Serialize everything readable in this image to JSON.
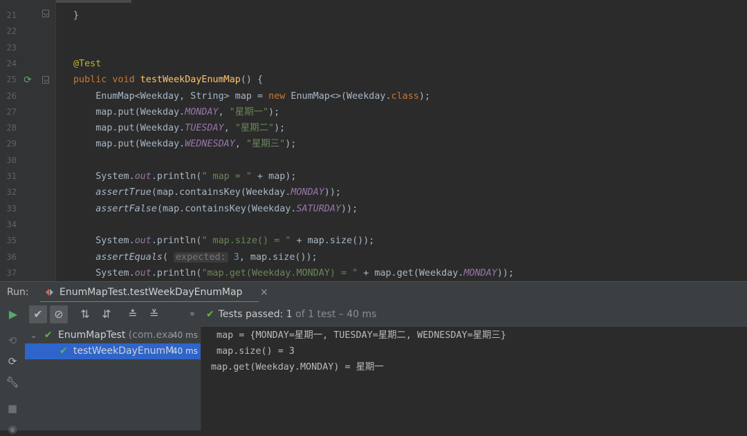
{
  "editor": {
    "lines": [
      {
        "n": "21",
        "html": "<span>}</span>"
      },
      {
        "n": "22",
        "html": ""
      },
      {
        "n": "23",
        "html": ""
      },
      {
        "n": "24",
        "html": "<span class=\"ann\">@Test</span>"
      },
      {
        "n": "25",
        "html": "<span class=\"kw\">public void </span><span class=\"fn\">testWeekDayEnumMap</span>() {"
      },
      {
        "n": "26",
        "html": "    EnumMap&lt;Weekday, String&gt; map = <span class=\"kw\">new </span>EnumMap&lt;&gt;(Weekday.<span class=\"kw\">class</span>);"
      },
      {
        "n": "27",
        "html": "    map.put(Weekday.<span class=\"stat\">MONDAY</span>, <span class=\"str\">\"星期一\"</span>);"
      },
      {
        "n": "28",
        "html": "    map.put(Weekday.<span class=\"stat\">TUESDAY</span>, <span class=\"str\">\"星期二\"</span>);"
      },
      {
        "n": "29",
        "html": "    map.put(Weekday.<span class=\"stat\">WEDNESDAY</span>, <span class=\"str\">\"星期三\"</span>);"
      },
      {
        "n": "30",
        "html": ""
      },
      {
        "n": "31",
        "html": "    System.<span class=\"field\">out</span>.println(<span class=\"str\">\" map = \"</span> + map);"
      },
      {
        "n": "32",
        "html": "    <span class=\"ital\">assertTrue</span>(map.containsKey(Weekday.<span class=\"stat\">MONDAY</span>));"
      },
      {
        "n": "33",
        "html": "    <span class=\"ital\">assertFalse</span>(map.containsKey(Weekday.<span class=\"stat\">SATURDAY</span>));"
      },
      {
        "n": "34",
        "html": ""
      },
      {
        "n": "35",
        "html": "    System.<span class=\"field\">out</span>.println(<span class=\"str\">\" map.size() = \"</span> + map.size());"
      },
      {
        "n": "36",
        "html": "    <span class=\"ital\">assertEquals</span>( <span class=\"hint\">expected:</span> <span class=\"num\">3</span>, map.size());"
      },
      {
        "n": "37",
        "html": "    System.<span class=\"field\">out</span>.println(<span class=\"str\">\"map.get(Weekday.MONDAY) = \"</span> + map.get(Weekday.<span class=\"stat\">MONDAY</span>));"
      }
    ]
  },
  "run_panel": {
    "label": "Run:",
    "tab_title": "EnumMapTest.testWeekDayEnumMap",
    "tab_close": "×",
    "status_prefix": "Tests passed: ",
    "status_count": "1",
    "status_suffix": " of 1 test – 40 ms",
    "tree": [
      {
        "name": "EnumMapTest",
        "pkg": " (com.exa",
        "time": "40 ms"
      },
      {
        "name": "testWeekDayEnumM",
        "pkg": "",
        "time": "40 ms"
      }
    ],
    "console": [
      " map = {MONDAY=星期一, TUESDAY=星期二, WEDNESDAY=星期三}",
      " map.size() = 3",
      "map.get(Weekday.MONDAY) = 星期一"
    ]
  },
  "icons": {
    "gutter_run": "run-test-icon",
    "toolbar": [
      "run-icon",
      "show-passed-icon",
      "show-ignored-icon",
      "sort-alpha-icon",
      "sort-duration-icon",
      "expand-all-icon",
      "collapse-all-icon"
    ],
    "side": [
      "rerun-failed-icon",
      "toggle-auto-test-icon",
      "settings-wrench-icon",
      "stop-icon",
      "camera-icon"
    ]
  },
  "colors": {
    "pass": "#62b543",
    "selection": "#2f65ca",
    "tab_underline": "#4a88c7"
  }
}
